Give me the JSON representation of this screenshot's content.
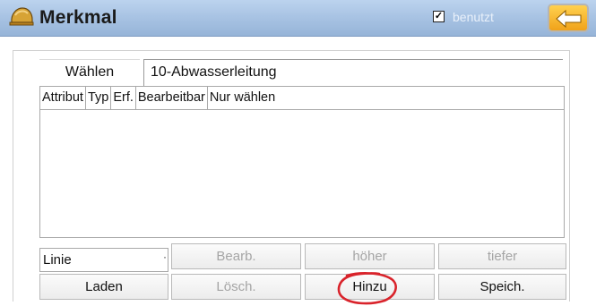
{
  "header": {
    "title": "Merkmal",
    "checkbox_label": "benutzt",
    "checkbox_checked": true,
    "checkbox_mark": "✓",
    "app_icon": "helmet-icon",
    "back_icon": "arrow-left-icon",
    "colors": {
      "bar": "#a9c4e4",
      "back_button": "#f7b52c"
    }
  },
  "selector": {
    "choose_label": "Wählen",
    "value": "10-Abwasserleitung"
  },
  "table": {
    "columns": [
      "Attribut",
      "Typ",
      "Erf.",
      "Bearbeitbar",
      "Nur wählen"
    ],
    "rows": []
  },
  "type_dropdown": {
    "value": "Linie",
    "arrow": "·"
  },
  "buttons": {
    "edit": "Bearb.",
    "up": "höher",
    "down": "tiefer",
    "load": "Laden",
    "delete": "Lösch.",
    "add": "Hinzu",
    "save": "Speich."
  },
  "annotation": {
    "color": "#d9232b",
    "target": "add"
  }
}
